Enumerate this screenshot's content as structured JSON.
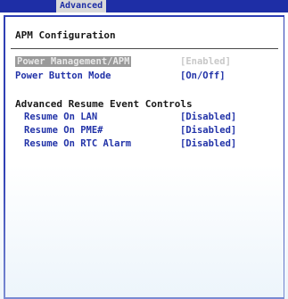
{
  "menubar": {
    "active_tab": "Advanced"
  },
  "panel": {
    "title": "APM Configuration",
    "items": [
      {
        "label": "Power Management/APM",
        "value": "[Enabled]"
      },
      {
        "label": "Power Button Mode",
        "value": "[On/Off]"
      }
    ],
    "section_title": "Advanced Resume Event Controls",
    "resume_items": [
      {
        "label": "Resume On LAN",
        "value": "[Disabled]"
      },
      {
        "label": "Resume On PME#",
        "value": "[Disabled]"
      },
      {
        "label": "Resume On RTC Alarm",
        "value": "[Disabled]"
      }
    ]
  },
  "colors": {
    "menubar_bg": "#1e2ea6",
    "item_text": "#2233a8",
    "title_text": "#1a1a1a"
  }
}
